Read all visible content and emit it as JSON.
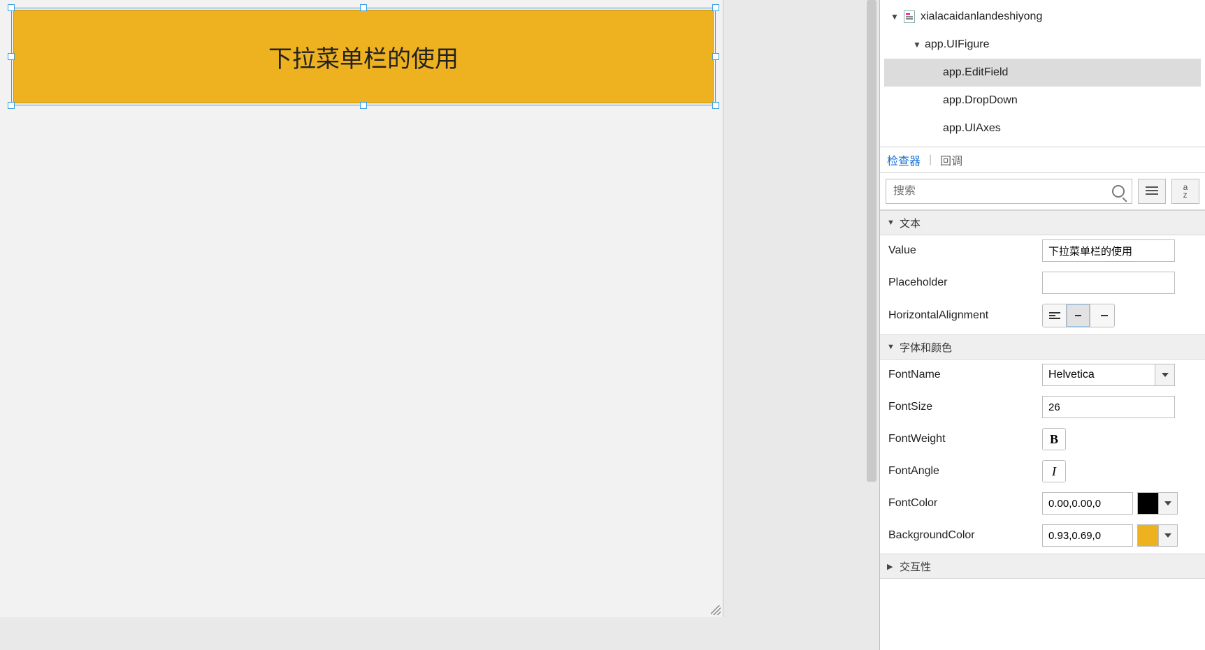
{
  "canvas": {
    "editfield_text": "下拉菜单栏的使用",
    "editfield_bg": "#eeb120"
  },
  "tree": {
    "root_label": "xialacaidanlandeshiyong",
    "figure_label": "app.UIFigure",
    "items": [
      "app.EditField",
      "app.DropDown",
      "app.UIAxes"
    ]
  },
  "tabs": {
    "inspector": "检查器",
    "callback": "回调"
  },
  "search": {
    "placeholder": "搜索"
  },
  "sections": {
    "text": "文本",
    "font": "字体和颜色",
    "interact": "交互性"
  },
  "props": {
    "value_label": "Value",
    "value": "下拉菜单栏的使用",
    "placeholder_label": "Placeholder",
    "placeholder": "",
    "halign_label": "HorizontalAlignment",
    "fontname_label": "FontName",
    "fontname": "Helvetica",
    "fontsize_label": "FontSize",
    "fontsize": "26",
    "fontweight_label": "FontWeight",
    "fontangle_label": "FontAngle",
    "fontcolor_label": "FontColor",
    "fontcolor": "0.00,0.00,0",
    "fontcolor_hex": "#000000",
    "bgcolor_label": "BackgroundColor",
    "bgcolor": "0.93,0.69,0",
    "bgcolor_hex": "#eeb120"
  }
}
